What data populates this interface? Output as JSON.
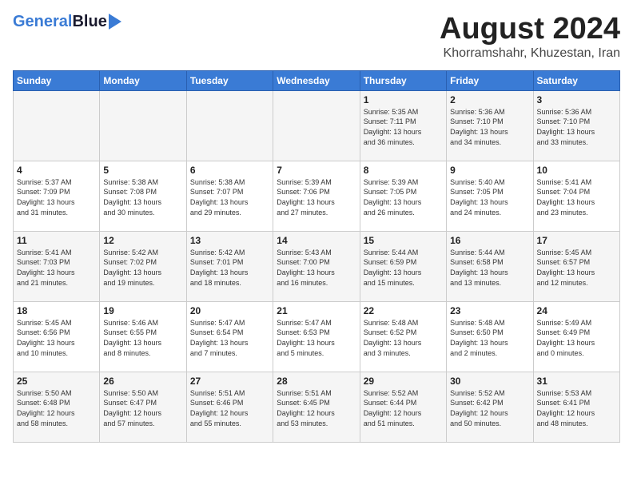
{
  "header": {
    "logo_general": "General",
    "logo_blue": "Blue",
    "month_year": "August 2024",
    "location": "Khorramshahr, Khuzestan, Iran"
  },
  "days_of_week": [
    "Sunday",
    "Monday",
    "Tuesday",
    "Wednesday",
    "Thursday",
    "Friday",
    "Saturday"
  ],
  "weeks": [
    [
      {
        "day": "",
        "info": ""
      },
      {
        "day": "",
        "info": ""
      },
      {
        "day": "",
        "info": ""
      },
      {
        "day": "",
        "info": ""
      },
      {
        "day": "1",
        "info": "Sunrise: 5:35 AM\nSunset: 7:11 PM\nDaylight: 13 hours\nand 36 minutes."
      },
      {
        "day": "2",
        "info": "Sunrise: 5:36 AM\nSunset: 7:10 PM\nDaylight: 13 hours\nand 34 minutes."
      },
      {
        "day": "3",
        "info": "Sunrise: 5:36 AM\nSunset: 7:10 PM\nDaylight: 13 hours\nand 33 minutes."
      }
    ],
    [
      {
        "day": "4",
        "info": "Sunrise: 5:37 AM\nSunset: 7:09 PM\nDaylight: 13 hours\nand 31 minutes."
      },
      {
        "day": "5",
        "info": "Sunrise: 5:38 AM\nSunset: 7:08 PM\nDaylight: 13 hours\nand 30 minutes."
      },
      {
        "day": "6",
        "info": "Sunrise: 5:38 AM\nSunset: 7:07 PM\nDaylight: 13 hours\nand 29 minutes."
      },
      {
        "day": "7",
        "info": "Sunrise: 5:39 AM\nSunset: 7:06 PM\nDaylight: 13 hours\nand 27 minutes."
      },
      {
        "day": "8",
        "info": "Sunrise: 5:39 AM\nSunset: 7:05 PM\nDaylight: 13 hours\nand 26 minutes."
      },
      {
        "day": "9",
        "info": "Sunrise: 5:40 AM\nSunset: 7:05 PM\nDaylight: 13 hours\nand 24 minutes."
      },
      {
        "day": "10",
        "info": "Sunrise: 5:41 AM\nSunset: 7:04 PM\nDaylight: 13 hours\nand 23 minutes."
      }
    ],
    [
      {
        "day": "11",
        "info": "Sunrise: 5:41 AM\nSunset: 7:03 PM\nDaylight: 13 hours\nand 21 minutes."
      },
      {
        "day": "12",
        "info": "Sunrise: 5:42 AM\nSunset: 7:02 PM\nDaylight: 13 hours\nand 19 minutes."
      },
      {
        "day": "13",
        "info": "Sunrise: 5:42 AM\nSunset: 7:01 PM\nDaylight: 13 hours\nand 18 minutes."
      },
      {
        "day": "14",
        "info": "Sunrise: 5:43 AM\nSunset: 7:00 PM\nDaylight: 13 hours\nand 16 minutes."
      },
      {
        "day": "15",
        "info": "Sunrise: 5:44 AM\nSunset: 6:59 PM\nDaylight: 13 hours\nand 15 minutes."
      },
      {
        "day": "16",
        "info": "Sunrise: 5:44 AM\nSunset: 6:58 PM\nDaylight: 13 hours\nand 13 minutes."
      },
      {
        "day": "17",
        "info": "Sunrise: 5:45 AM\nSunset: 6:57 PM\nDaylight: 13 hours\nand 12 minutes."
      }
    ],
    [
      {
        "day": "18",
        "info": "Sunrise: 5:45 AM\nSunset: 6:56 PM\nDaylight: 13 hours\nand 10 minutes."
      },
      {
        "day": "19",
        "info": "Sunrise: 5:46 AM\nSunset: 6:55 PM\nDaylight: 13 hours\nand 8 minutes."
      },
      {
        "day": "20",
        "info": "Sunrise: 5:47 AM\nSunset: 6:54 PM\nDaylight: 13 hours\nand 7 minutes."
      },
      {
        "day": "21",
        "info": "Sunrise: 5:47 AM\nSunset: 6:53 PM\nDaylight: 13 hours\nand 5 minutes."
      },
      {
        "day": "22",
        "info": "Sunrise: 5:48 AM\nSunset: 6:52 PM\nDaylight: 13 hours\nand 3 minutes."
      },
      {
        "day": "23",
        "info": "Sunrise: 5:48 AM\nSunset: 6:50 PM\nDaylight: 13 hours\nand 2 minutes."
      },
      {
        "day": "24",
        "info": "Sunrise: 5:49 AM\nSunset: 6:49 PM\nDaylight: 13 hours\nand 0 minutes."
      }
    ],
    [
      {
        "day": "25",
        "info": "Sunrise: 5:50 AM\nSunset: 6:48 PM\nDaylight: 12 hours\nand 58 minutes."
      },
      {
        "day": "26",
        "info": "Sunrise: 5:50 AM\nSunset: 6:47 PM\nDaylight: 12 hours\nand 57 minutes."
      },
      {
        "day": "27",
        "info": "Sunrise: 5:51 AM\nSunset: 6:46 PM\nDaylight: 12 hours\nand 55 minutes."
      },
      {
        "day": "28",
        "info": "Sunrise: 5:51 AM\nSunset: 6:45 PM\nDaylight: 12 hours\nand 53 minutes."
      },
      {
        "day": "29",
        "info": "Sunrise: 5:52 AM\nSunset: 6:44 PM\nDaylight: 12 hours\nand 51 minutes."
      },
      {
        "day": "30",
        "info": "Sunrise: 5:52 AM\nSunset: 6:42 PM\nDaylight: 12 hours\nand 50 minutes."
      },
      {
        "day": "31",
        "info": "Sunrise: 5:53 AM\nSunset: 6:41 PM\nDaylight: 12 hours\nand 48 minutes."
      }
    ]
  ]
}
